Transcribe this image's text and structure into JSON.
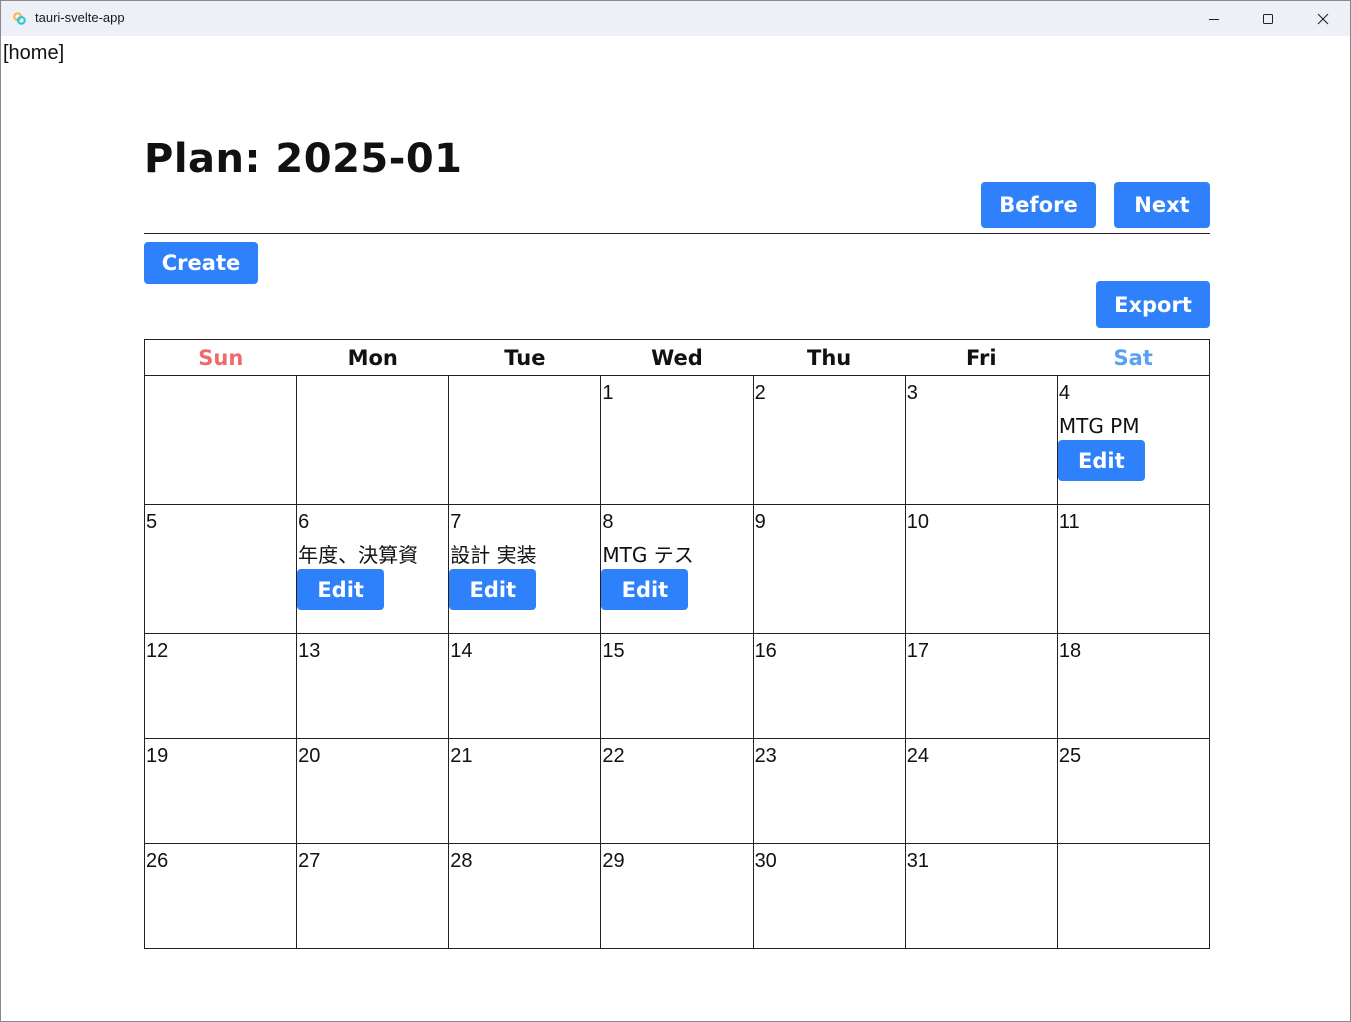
{
  "window": {
    "title": "tauri-svelte-app"
  },
  "nav": {
    "home_label": "[home]"
  },
  "page": {
    "title": "Plan: 2025-01"
  },
  "toolbar": {
    "before_label": "Before",
    "next_label": "Next",
    "create_label": "Create",
    "export_label": "Export"
  },
  "colors": {
    "accent": "#2f80fb",
    "sunday": "#ef6b6b",
    "saturday": "#5aa0f0"
  },
  "calendar": {
    "headers": [
      "Sun",
      "Mon",
      "Tue",
      "Wed",
      "Thu",
      "Fri",
      "Sat"
    ],
    "edit_label": "Edit",
    "weeks": [
      [
        {
          "day": "",
          "plan": ""
        },
        {
          "day": "",
          "plan": ""
        },
        {
          "day": "",
          "plan": ""
        },
        {
          "day": "1",
          "plan": ""
        },
        {
          "day": "2",
          "plan": ""
        },
        {
          "day": "3",
          "plan": ""
        },
        {
          "day": "4",
          "plan": "MTG PM"
        }
      ],
      [
        {
          "day": "5",
          "plan": ""
        },
        {
          "day": "6",
          "plan": "年度、決算資"
        },
        {
          "day": "7",
          "plan": "設計 実装"
        },
        {
          "day": "8",
          "plan": "MTG テス"
        },
        {
          "day": "9",
          "plan": ""
        },
        {
          "day": "10",
          "plan": ""
        },
        {
          "day": "11",
          "plan": ""
        }
      ],
      [
        {
          "day": "12",
          "plan": ""
        },
        {
          "day": "13",
          "plan": ""
        },
        {
          "day": "14",
          "plan": ""
        },
        {
          "day": "15",
          "plan": ""
        },
        {
          "day": "16",
          "plan": ""
        },
        {
          "day": "17",
          "plan": ""
        },
        {
          "day": "18",
          "plan": ""
        }
      ],
      [
        {
          "day": "19",
          "plan": ""
        },
        {
          "day": "20",
          "plan": ""
        },
        {
          "day": "21",
          "plan": ""
        },
        {
          "day": "22",
          "plan": ""
        },
        {
          "day": "23",
          "plan": ""
        },
        {
          "day": "24",
          "plan": ""
        },
        {
          "day": "25",
          "plan": ""
        }
      ],
      [
        {
          "day": "26",
          "plan": ""
        },
        {
          "day": "27",
          "plan": ""
        },
        {
          "day": "28",
          "plan": ""
        },
        {
          "day": "29",
          "plan": ""
        },
        {
          "day": "30",
          "plan": ""
        },
        {
          "day": "31",
          "plan": ""
        },
        {
          "day": "",
          "plan": ""
        }
      ]
    ]
  }
}
